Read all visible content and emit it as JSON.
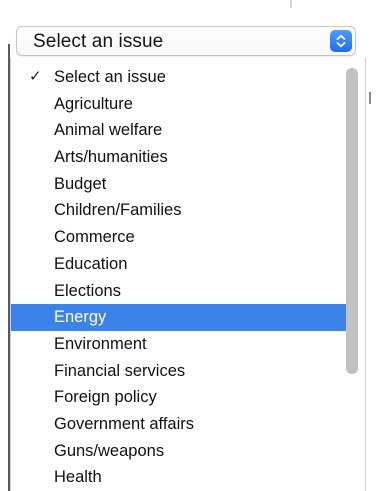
{
  "select": {
    "value": "Select an issue",
    "accent": "#2a7ff5"
  },
  "menu": {
    "selected_index": 0,
    "highlighted_index": 9,
    "highlight_color": "#3b83e8",
    "items": [
      {
        "label": "Select an issue"
      },
      {
        "label": "Agriculture"
      },
      {
        "label": "Animal welfare"
      },
      {
        "label": "Arts/humanities"
      },
      {
        "label": "Budget"
      },
      {
        "label": "Children/Families"
      },
      {
        "label": "Commerce"
      },
      {
        "label": "Education"
      },
      {
        "label": "Elections"
      },
      {
        "label": "Energy"
      },
      {
        "label": "Environment"
      },
      {
        "label": "Financial services"
      },
      {
        "label": "Foreign policy"
      },
      {
        "label": "Government affairs"
      },
      {
        "label": "Guns/weapons"
      },
      {
        "label": "Health"
      }
    ]
  },
  "icons": {
    "check": "checkmark-icon",
    "stepper": "up-down-chevron-icon"
  }
}
